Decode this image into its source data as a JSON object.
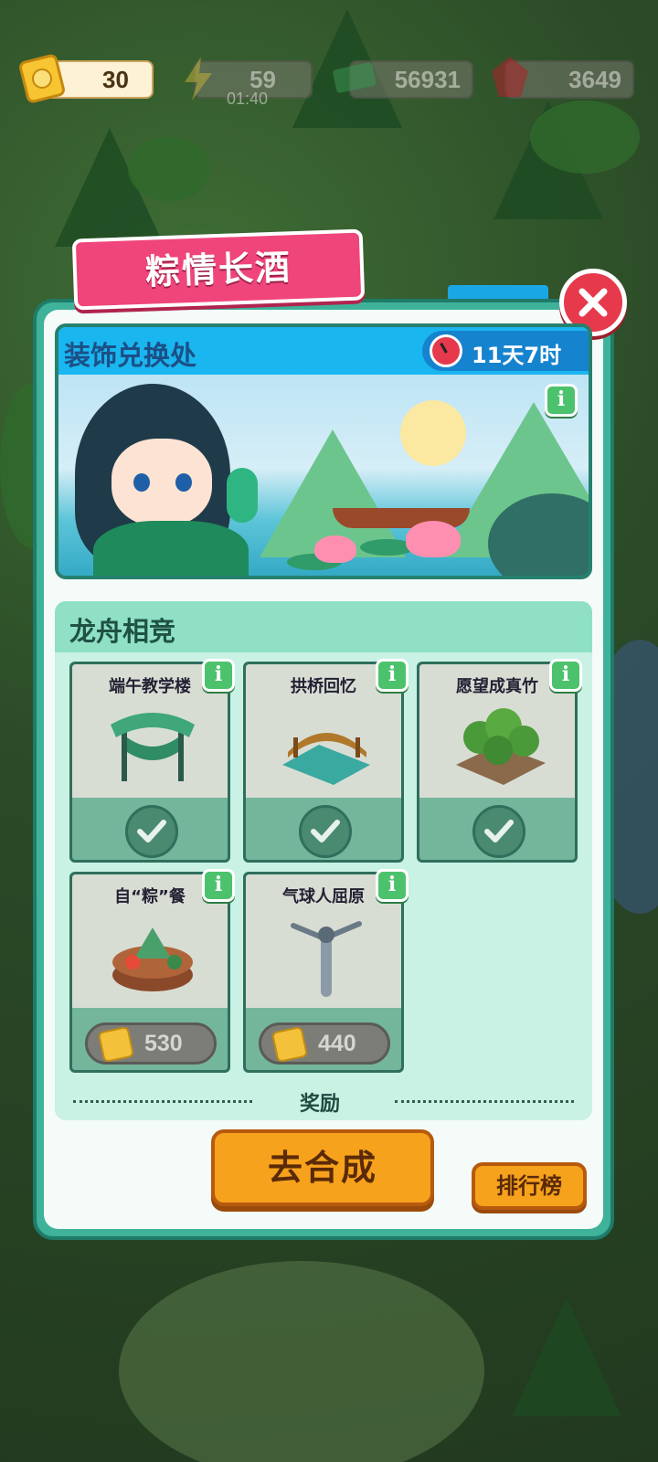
{
  "resources": {
    "tickets": "30",
    "energy": "59",
    "energy_timer": "01:40",
    "cash": "56931",
    "gems": "3649"
  },
  "event": {
    "title": "粽情长酒",
    "banner_title": "装饰兑换处",
    "time_left": "11天7时"
  },
  "section": {
    "title": "龙舟相竞",
    "items": [
      {
        "name": "端午教学楼",
        "status": "owned"
      },
      {
        "name": "拱桥回忆",
        "status": "owned"
      },
      {
        "name": "愿望成真竹",
        "status": "owned"
      },
      {
        "name": "自“粽”餐",
        "status": "price",
        "price": "530"
      },
      {
        "name": "气球人屈原",
        "status": "price",
        "price": "440"
      }
    ],
    "reward_label": "奖励"
  },
  "buttons": {
    "go_merge": "去合成",
    "leaderboard": "排行榜"
  },
  "colors": {
    "title_tab": "#f0457a",
    "dialog_frame": "#3fb29a",
    "banner_header": "#19b6f0",
    "primary_button": "#f6a21c",
    "close_button": "#e63a4c"
  }
}
